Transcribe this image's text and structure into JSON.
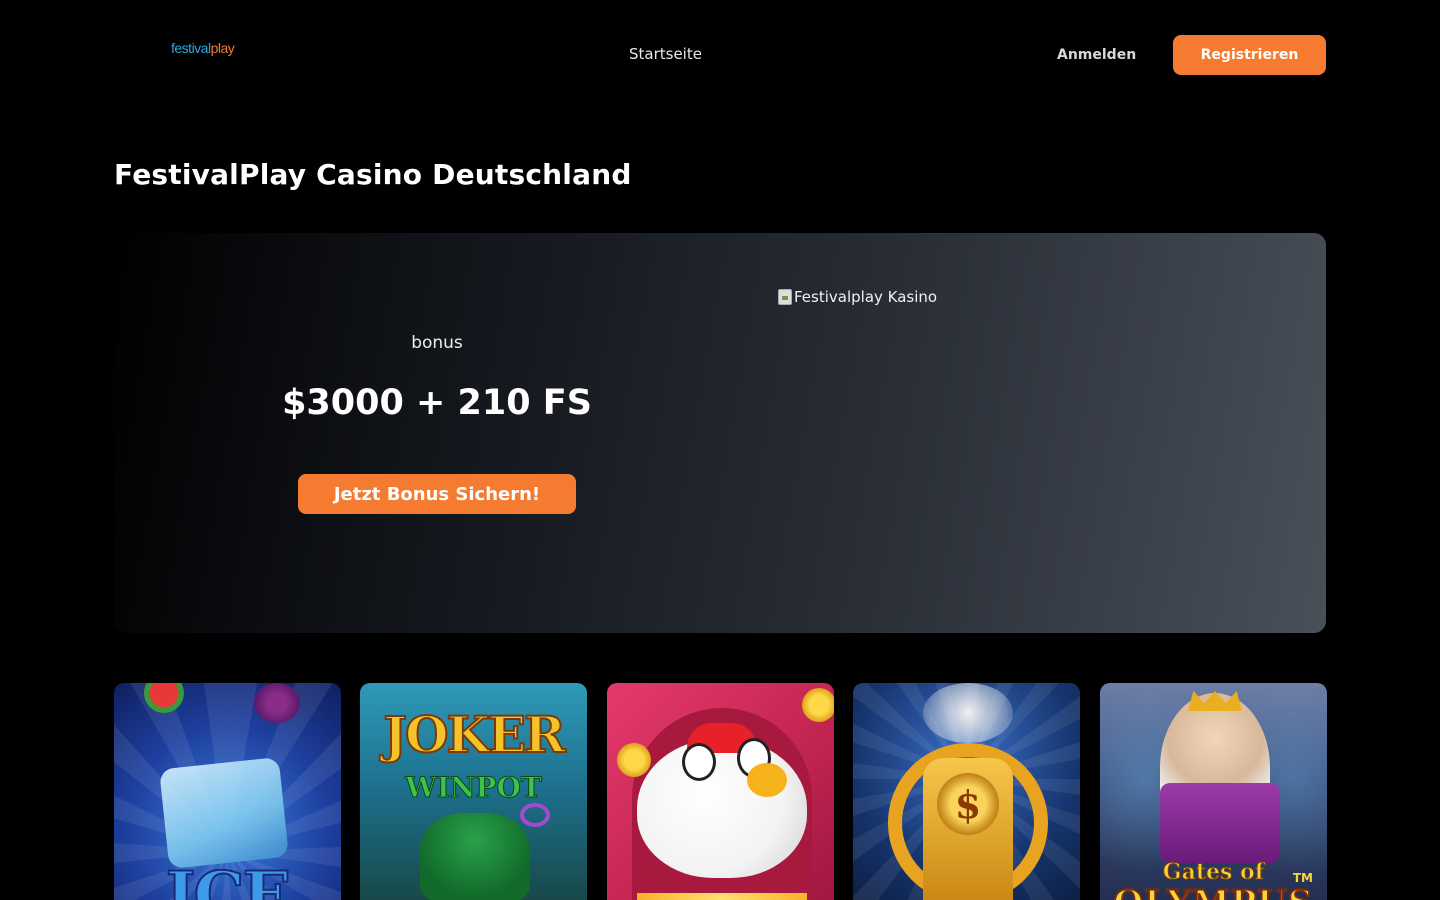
{
  "header": {
    "logo_part1": "festival",
    "logo_part2": "play",
    "nav_home": "Startseite",
    "login_label": "Anmelden",
    "register_label": "Registrieren"
  },
  "page_title": "FestivalPlay Casino Deutschland",
  "hero": {
    "bonus_label": "bonus",
    "bonus_value": "$3000 + 210 FS",
    "cta_label": "Jetzt Bonus Sichern!",
    "image_alt": "Festivalplay Kasino"
  },
  "games": [
    {
      "title": "ICE"
    },
    {
      "title": "JOKER",
      "subtitle": "WINPOT"
    },
    {
      "title": ""
    },
    {
      "title": ""
    },
    {
      "title": "Gates of",
      "subtitle": "OLYMPUS",
      "mark": "TM"
    }
  ],
  "colors": {
    "accent": "#f47b30",
    "logo_blue": "#29a8e0",
    "background": "#000000"
  }
}
